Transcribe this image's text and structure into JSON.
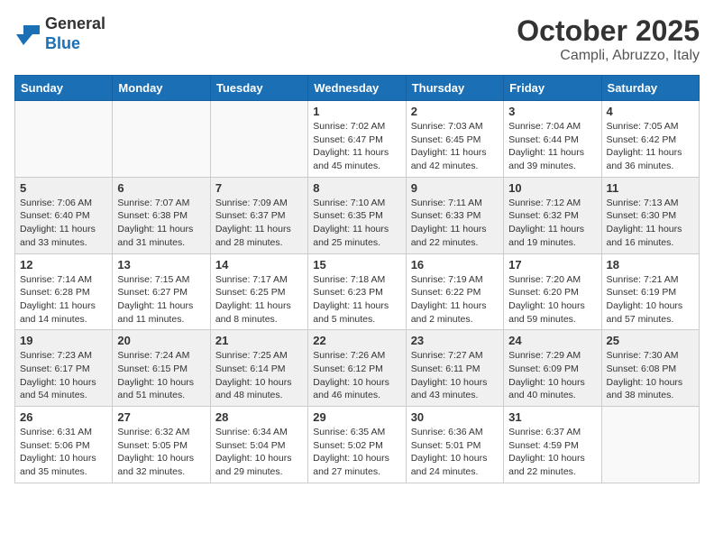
{
  "header": {
    "logo": {
      "general": "General",
      "blue": "Blue"
    },
    "title": "October 2025",
    "subtitle": "Campli, Abruzzo, Italy"
  },
  "weekdays": [
    "Sunday",
    "Monday",
    "Tuesday",
    "Wednesday",
    "Thursday",
    "Friday",
    "Saturday"
  ],
  "weeks": [
    [
      {
        "day": "",
        "info": ""
      },
      {
        "day": "",
        "info": ""
      },
      {
        "day": "",
        "info": ""
      },
      {
        "day": "1",
        "info": "Sunrise: 7:02 AM\nSunset: 6:47 PM\nDaylight: 11 hours\nand 45 minutes."
      },
      {
        "day": "2",
        "info": "Sunrise: 7:03 AM\nSunset: 6:45 PM\nDaylight: 11 hours\nand 42 minutes."
      },
      {
        "day": "3",
        "info": "Sunrise: 7:04 AM\nSunset: 6:44 PM\nDaylight: 11 hours\nand 39 minutes."
      },
      {
        "day": "4",
        "info": "Sunrise: 7:05 AM\nSunset: 6:42 PM\nDaylight: 11 hours\nand 36 minutes."
      }
    ],
    [
      {
        "day": "5",
        "info": "Sunrise: 7:06 AM\nSunset: 6:40 PM\nDaylight: 11 hours\nand 33 minutes."
      },
      {
        "day": "6",
        "info": "Sunrise: 7:07 AM\nSunset: 6:38 PM\nDaylight: 11 hours\nand 31 minutes."
      },
      {
        "day": "7",
        "info": "Sunrise: 7:09 AM\nSunset: 6:37 PM\nDaylight: 11 hours\nand 28 minutes."
      },
      {
        "day": "8",
        "info": "Sunrise: 7:10 AM\nSunset: 6:35 PM\nDaylight: 11 hours\nand 25 minutes."
      },
      {
        "day": "9",
        "info": "Sunrise: 7:11 AM\nSunset: 6:33 PM\nDaylight: 11 hours\nand 22 minutes."
      },
      {
        "day": "10",
        "info": "Sunrise: 7:12 AM\nSunset: 6:32 PM\nDaylight: 11 hours\nand 19 minutes."
      },
      {
        "day": "11",
        "info": "Sunrise: 7:13 AM\nSunset: 6:30 PM\nDaylight: 11 hours\nand 16 minutes."
      }
    ],
    [
      {
        "day": "12",
        "info": "Sunrise: 7:14 AM\nSunset: 6:28 PM\nDaylight: 11 hours\nand 14 minutes."
      },
      {
        "day": "13",
        "info": "Sunrise: 7:15 AM\nSunset: 6:27 PM\nDaylight: 11 hours\nand 11 minutes."
      },
      {
        "day": "14",
        "info": "Sunrise: 7:17 AM\nSunset: 6:25 PM\nDaylight: 11 hours\nand 8 minutes."
      },
      {
        "day": "15",
        "info": "Sunrise: 7:18 AM\nSunset: 6:23 PM\nDaylight: 11 hours\nand 5 minutes."
      },
      {
        "day": "16",
        "info": "Sunrise: 7:19 AM\nSunset: 6:22 PM\nDaylight: 11 hours\nand 2 minutes."
      },
      {
        "day": "17",
        "info": "Sunrise: 7:20 AM\nSunset: 6:20 PM\nDaylight: 10 hours\nand 59 minutes."
      },
      {
        "day": "18",
        "info": "Sunrise: 7:21 AM\nSunset: 6:19 PM\nDaylight: 10 hours\nand 57 minutes."
      }
    ],
    [
      {
        "day": "19",
        "info": "Sunrise: 7:23 AM\nSunset: 6:17 PM\nDaylight: 10 hours\nand 54 minutes."
      },
      {
        "day": "20",
        "info": "Sunrise: 7:24 AM\nSunset: 6:15 PM\nDaylight: 10 hours\nand 51 minutes."
      },
      {
        "day": "21",
        "info": "Sunrise: 7:25 AM\nSunset: 6:14 PM\nDaylight: 10 hours\nand 48 minutes."
      },
      {
        "day": "22",
        "info": "Sunrise: 7:26 AM\nSunset: 6:12 PM\nDaylight: 10 hours\nand 46 minutes."
      },
      {
        "day": "23",
        "info": "Sunrise: 7:27 AM\nSunset: 6:11 PM\nDaylight: 10 hours\nand 43 minutes."
      },
      {
        "day": "24",
        "info": "Sunrise: 7:29 AM\nSunset: 6:09 PM\nDaylight: 10 hours\nand 40 minutes."
      },
      {
        "day": "25",
        "info": "Sunrise: 7:30 AM\nSunset: 6:08 PM\nDaylight: 10 hours\nand 38 minutes."
      }
    ],
    [
      {
        "day": "26",
        "info": "Sunrise: 6:31 AM\nSunset: 5:06 PM\nDaylight: 10 hours\nand 35 minutes."
      },
      {
        "day": "27",
        "info": "Sunrise: 6:32 AM\nSunset: 5:05 PM\nDaylight: 10 hours\nand 32 minutes."
      },
      {
        "day": "28",
        "info": "Sunrise: 6:34 AM\nSunset: 5:04 PM\nDaylight: 10 hours\nand 29 minutes."
      },
      {
        "day": "29",
        "info": "Sunrise: 6:35 AM\nSunset: 5:02 PM\nDaylight: 10 hours\nand 27 minutes."
      },
      {
        "day": "30",
        "info": "Sunrise: 6:36 AM\nSunset: 5:01 PM\nDaylight: 10 hours\nand 24 minutes."
      },
      {
        "day": "31",
        "info": "Sunrise: 6:37 AM\nSunset: 4:59 PM\nDaylight: 10 hours\nand 22 minutes."
      },
      {
        "day": "",
        "info": ""
      }
    ]
  ]
}
